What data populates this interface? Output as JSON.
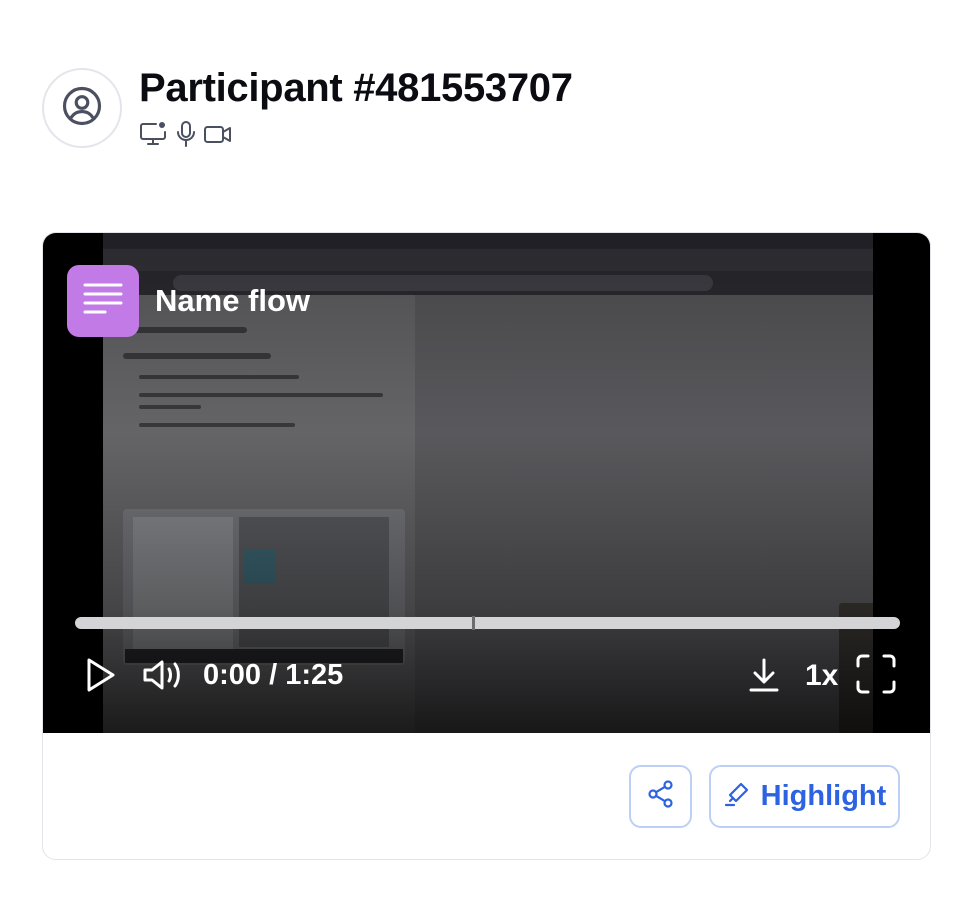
{
  "participant": {
    "title": "Participant #481553707",
    "avatar_icon": "user-circle-icon",
    "devices": [
      "screen-share-icon",
      "microphone-icon",
      "video-camera-icon"
    ]
  },
  "player": {
    "task_label": "Name flow",
    "task_icon": "text-lines-icon",
    "time_display": "0:00 / 1:25",
    "playback_progress": 0,
    "speed": "1x",
    "controls": [
      "play-icon",
      "volume-icon",
      "download-icon",
      "fullscreen-icon"
    ]
  },
  "actions": {
    "share_icon": "share-icon",
    "highlight_label": "Highlight",
    "highlight_icon": "highlighter-icon"
  },
  "colors": {
    "accent": "#2d63e0",
    "task_icon_bg": "#c27ae6",
    "button_border": "#bcd0f7",
    "text": "#0b0b12",
    "icon_muted": "#4b5060"
  }
}
